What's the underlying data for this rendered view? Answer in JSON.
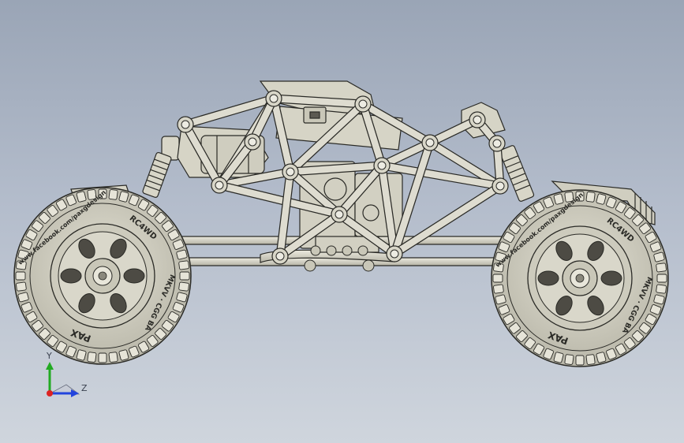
{
  "triad": {
    "y_label": "Y",
    "z_label": "Z"
  },
  "tire": {
    "brand": "PAX",
    "tread_text": "RC4WD",
    "model_text": "MKVV · CGG BA",
    "url_text": "www.facebook.com/paxgdesign"
  },
  "colors": {
    "background_top": "#9aa5b6",
    "background_bottom": "#cfd5dd",
    "model_fill": "#d8d6c8",
    "model_edge": "#2a2a26",
    "axis_y": "#22aa22",
    "axis_z": "#2244dd",
    "origin": "#dd2222"
  }
}
